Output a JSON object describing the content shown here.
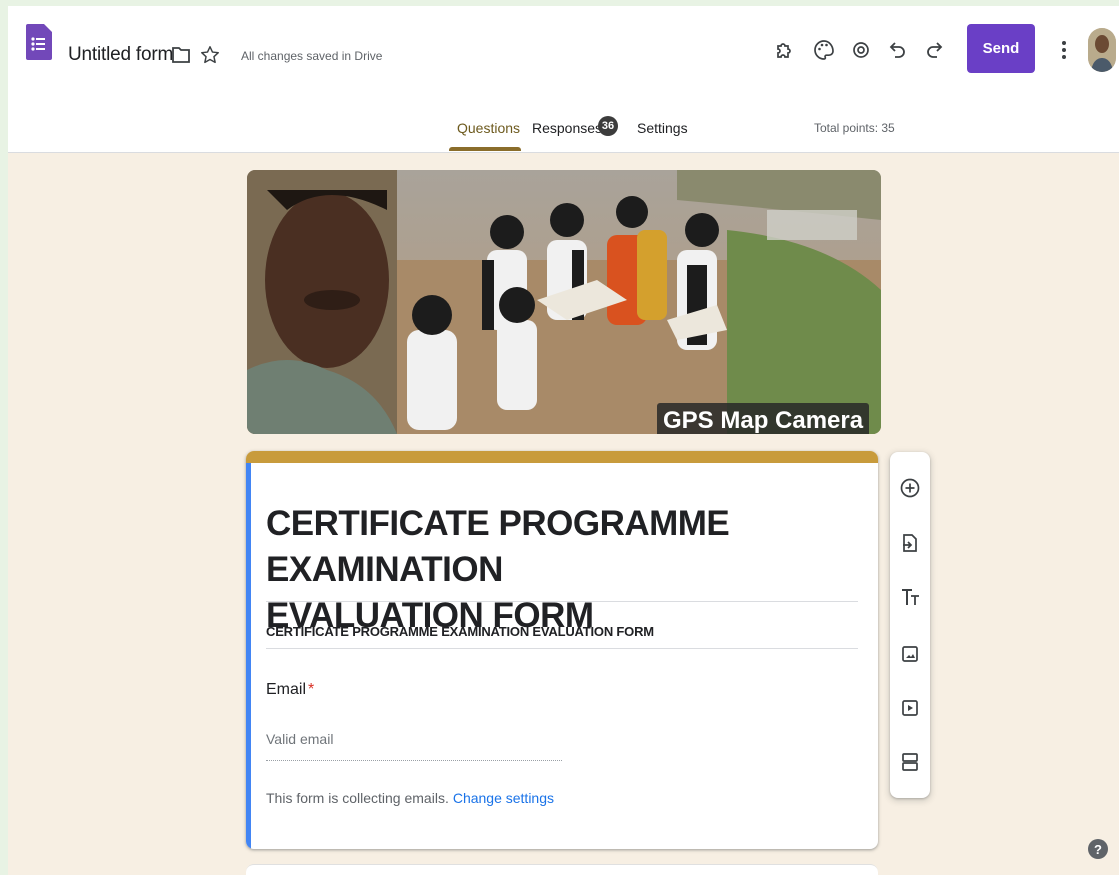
{
  "app": {
    "title": "Untitled form",
    "save_status": "All changes saved in Drive",
    "send_label": "Send"
  },
  "tabs": {
    "questions": "Questions",
    "responses": "Responses",
    "responses_count": "36",
    "settings": "Settings"
  },
  "total_points": "Total points: 35",
  "banner": {
    "overlay_text": "GPS Map Camera"
  },
  "form": {
    "heading_line1": "CERTIFICATE PROGRAMME EXAMINATION",
    "heading_line2": "EVALUATION FORM",
    "description": "CERTIFICATE PROGRAMME EXAMINATION  EVALUATION FORM",
    "email_label": "Email",
    "required_mark": "*",
    "email_placeholder": "Valid email",
    "collecting_note": "This form is collecting emails.",
    "change_settings_label": "Change settings"
  },
  "help_label": "?",
  "icons": {
    "toolbar": [
      "addon-puzzle-icon",
      "palette-icon",
      "preview-eye-icon",
      "undo-icon",
      "redo-icon",
      "more-vert-icon"
    ],
    "side_toolbar": [
      "add-question-icon",
      "import-questions-icon",
      "add-title-icon",
      "add-image-icon",
      "add-video-icon",
      "add-section-icon"
    ]
  },
  "colors": {
    "accent": "#6a3fc6",
    "theme_gold": "#c89b3c",
    "page_background": "#f7efe3",
    "active_card_bar": "#4285f4"
  }
}
